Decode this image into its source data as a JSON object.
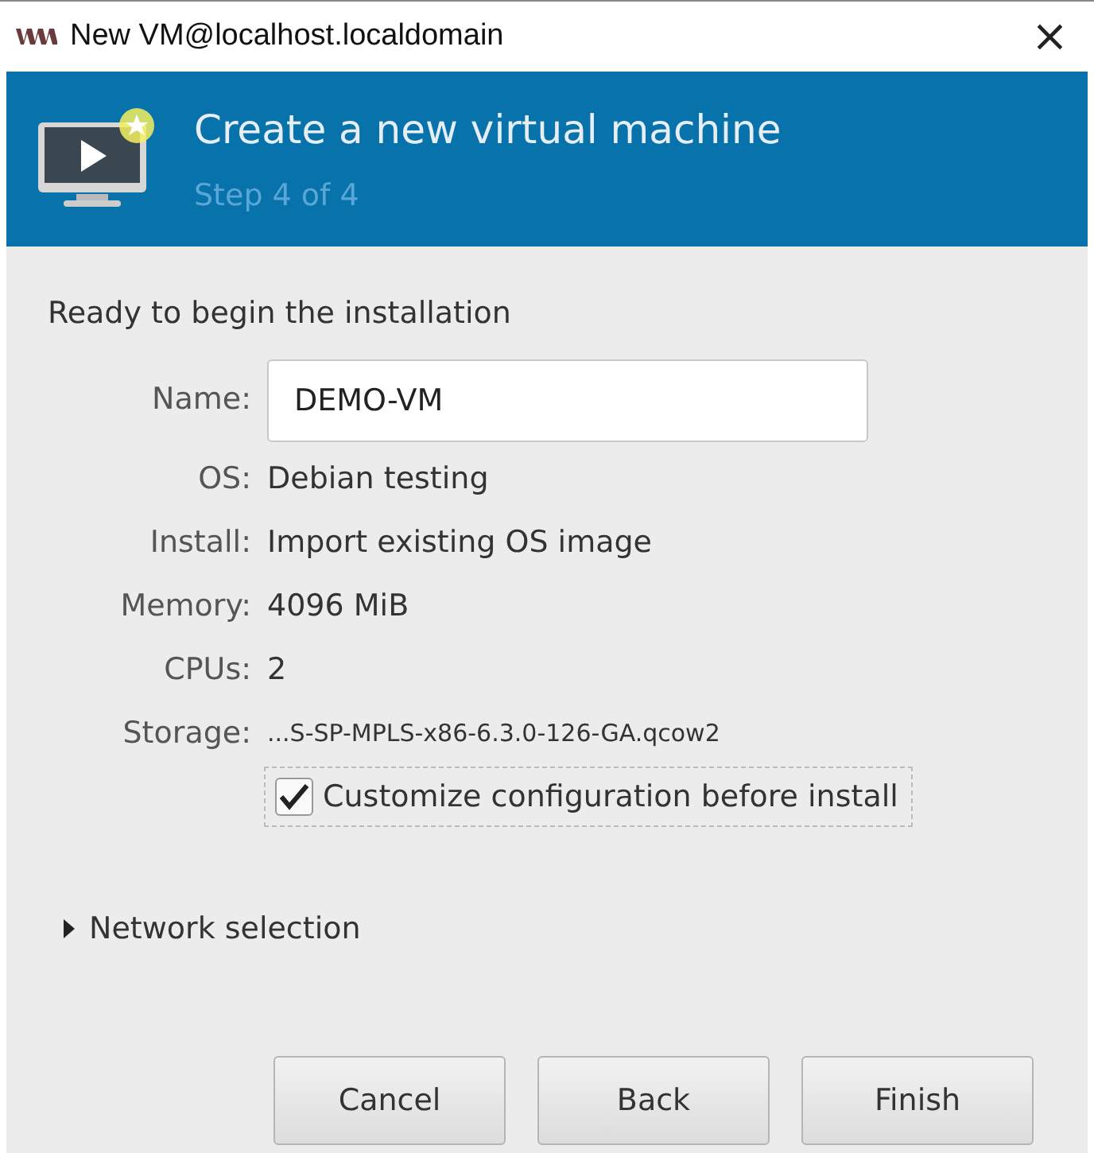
{
  "window": {
    "title": "New VM@localhost.localdomain",
    "close": "×"
  },
  "header": {
    "title": "Create a new virtual machine",
    "step": "Step 4 of 4"
  },
  "summary": {
    "heading": "Ready to begin the installation",
    "name": {
      "label": "Name:",
      "value": "DEMO-VM"
    },
    "rows": [
      {
        "label": "OS:",
        "value": "Debian testing",
        "kind": "normal"
      },
      {
        "label": "Install:",
        "value": "Import existing OS image",
        "kind": "normal"
      },
      {
        "label": "Memory:",
        "value": "4096 MiB",
        "kind": "normal"
      },
      {
        "label": "CPUs:",
        "value": "2",
        "kind": "normal"
      },
      {
        "label": "Storage:",
        "value": "...S-SP-MPLS-x86-6.3.0-126-GA.qcow2",
        "kind": "small"
      }
    ],
    "customize": {
      "label": "Customize configuration before install",
      "checked": true
    }
  },
  "network": {
    "label": "Network selection",
    "expanded": false
  },
  "buttons": [
    "Cancel",
    "Back",
    "Finish"
  ]
}
